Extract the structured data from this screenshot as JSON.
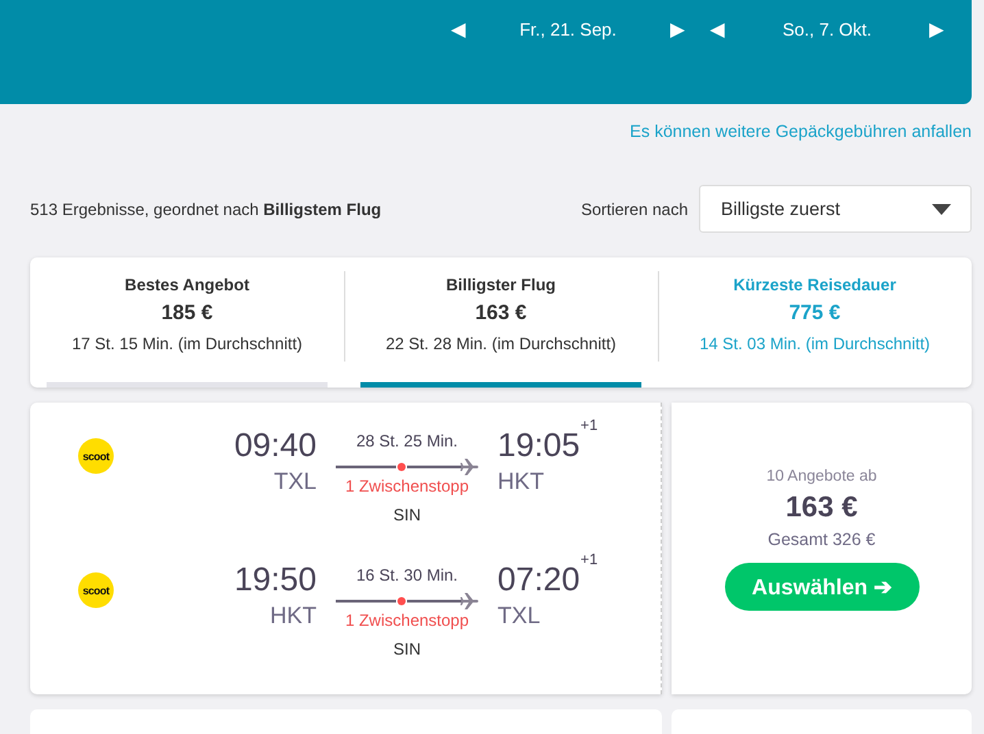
{
  "header": {
    "date_pickers": [
      {
        "prev": "◀",
        "date": "Fr., 21. Sep.",
        "next": "▶"
      },
      {
        "prev": "◀",
        "date": "So., 7. Okt.",
        "next": "▶"
      }
    ]
  },
  "baggage_link": "Es können weitere Gepäckgebühren anfallen",
  "results_summary": "513 Ergebnisse, geordnet nach **Billigstem Flug**",
  "sort": {
    "label": "Sortieren nach",
    "value": "Billigste zuerst"
  },
  "tabs": [
    {
      "title": "Bestes Angebot",
      "price": "185 €",
      "duration": "17 St. 15 Min. (im Durchschnitt)",
      "selected": false,
      "hovered": true,
      "color": "#333333"
    },
    {
      "title": "Billigster Flug",
      "price": "163 €",
      "duration": "22 St. 28 Min. (im Durchschnitt)",
      "selected": true,
      "hovered": false,
      "color": "#333333"
    },
    {
      "title": "Kürzeste Reisedauer",
      "price": "775 €",
      "duration": "14 St. 03 Min. (im Durchschnitt)",
      "selected": false,
      "hovered": false,
      "color": "#1ba3c9"
    }
  ],
  "result": {
    "legs": [
      {
        "airline": "scoot",
        "departure_time": "09:40",
        "departure_airport": "TXL",
        "duration": "28 St. 25 Min.",
        "stops": "1 Zwischenstopp",
        "via": "SIN",
        "arrival_time": "19:05",
        "day_offset": "+1",
        "arrival_airport": "HKT"
      },
      {
        "airline": "scoot",
        "departure_time": "19:50",
        "departure_airport": "HKT",
        "duration": "16 St. 30 Min.",
        "stops": "1 Zwischenstopp",
        "via": "SIN",
        "arrival_time": "07:20",
        "day_offset": "+1",
        "arrival_airport": "TXL"
      }
    ],
    "offers": "10 Angebote ab",
    "price": "163 €",
    "total": "Gesamt 326 €",
    "button": "Auswählen ➔"
  }
}
